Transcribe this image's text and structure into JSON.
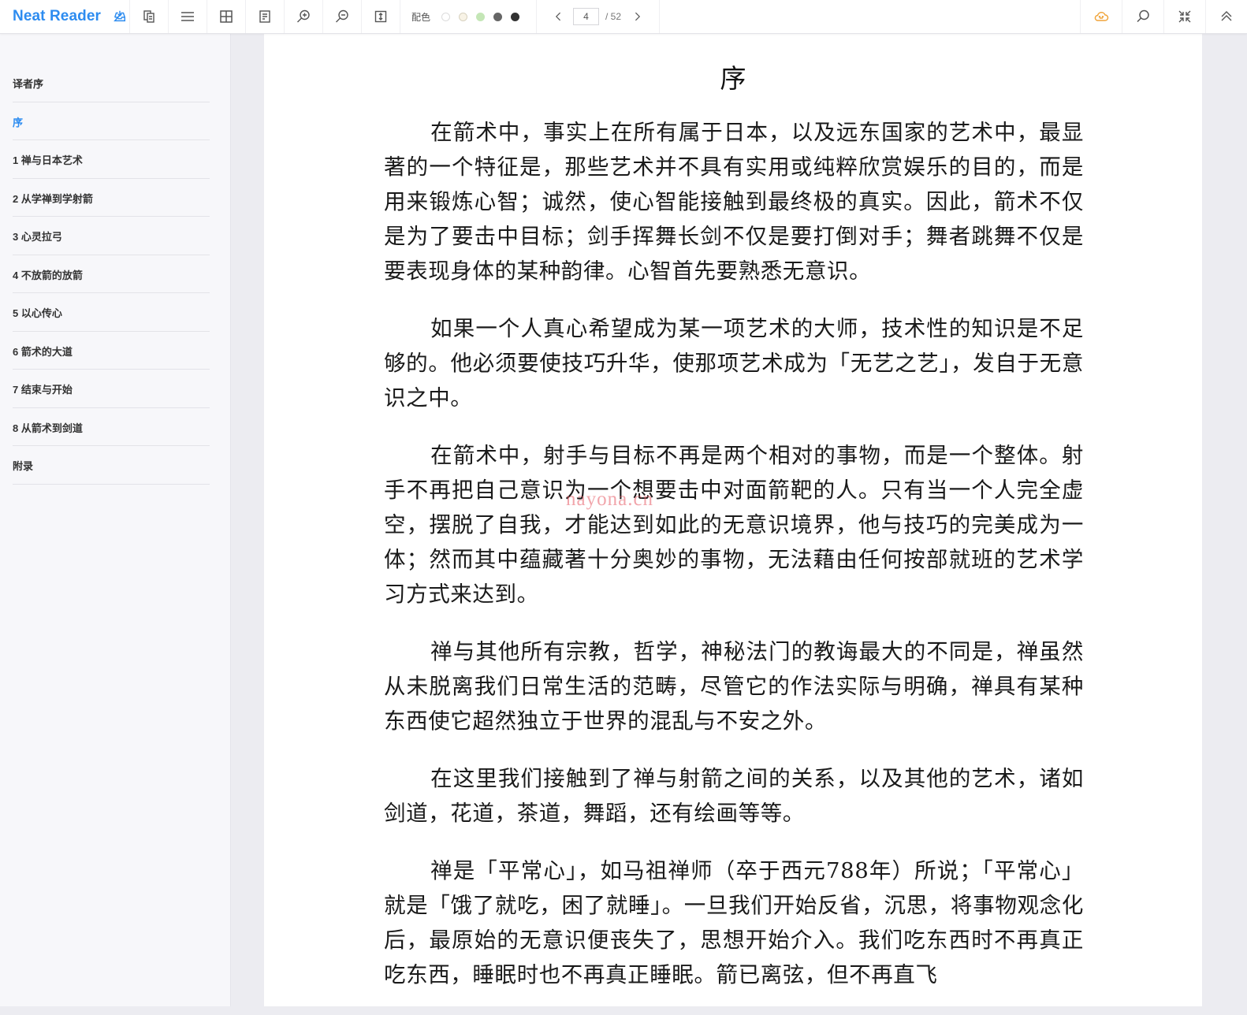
{
  "app": {
    "name": "Neat Reader"
  },
  "toolbar": {
    "buttons": [
      {
        "name": "import",
        "icon": "tray-download-icon"
      },
      {
        "name": "copy",
        "icon": "copy-icon"
      },
      {
        "name": "toc",
        "icon": "list-icon"
      },
      {
        "name": "layout",
        "icon": "grid-icon"
      },
      {
        "name": "notes",
        "icon": "document-icon"
      },
      {
        "name": "zoom-in",
        "icon": "zoom-in-icon"
      },
      {
        "name": "zoom-out",
        "icon": "zoom-out-icon"
      },
      {
        "name": "fit-height",
        "icon": "fit-vertical-icon"
      }
    ],
    "color_scheme": {
      "label": "配色",
      "swatches": [
        {
          "fill": "#ffffff",
          "border": "#dcdcdc"
        },
        {
          "fill": "#f8f3e6",
          "border": "#d8d2c0"
        },
        {
          "fill": "#c4e6b6",
          "border": "#c4e6b6"
        },
        {
          "fill": "#666666",
          "border": "#666666"
        },
        {
          "fill": "#333333",
          "border": "#333333"
        }
      ]
    },
    "pager": {
      "current_page": "4",
      "total": "/ 52"
    },
    "right_buttons": [
      {
        "name": "cloud-sync",
        "icon": "cloud-icon"
      },
      {
        "name": "search",
        "icon": "search-icon"
      },
      {
        "name": "fullscreen-exit",
        "icon": "compress-icon"
      },
      {
        "name": "collapse",
        "icon": "double-chevron-up-icon"
      }
    ]
  },
  "colors": {
    "accent": "#2d8cf0",
    "cloud": "#f0a43a"
  },
  "sidebar": {
    "toc": [
      {
        "label": "译者序",
        "active": false
      },
      {
        "label": "序",
        "active": true
      },
      {
        "label": "1 禅与日本艺术",
        "active": false
      },
      {
        "label": "2 从学禅到学射箭",
        "active": false
      },
      {
        "label": "3 心灵拉弓",
        "active": false
      },
      {
        "label": "4 不放箭的放箭",
        "active": false
      },
      {
        "label": "5 以心传心",
        "active": false
      },
      {
        "label": "6 箭术的大道",
        "active": false
      },
      {
        "label": "7 结束与开始",
        "active": false
      },
      {
        "label": "8 从箭术到剑道",
        "active": false
      },
      {
        "label": "附录",
        "active": false
      }
    ]
  },
  "page": {
    "title": "序",
    "paragraphs": [
      "在箭术中，事实上在所有属于日本，以及远东国家的艺术中，最显著的一个特征是，那些艺术并不具有实用或纯粹欣赏娱乐的目的，而是用来锻炼心智；诚然，使心智能接触到最终极的真实。因此，箭术不仅是为了要击中目标；剑手挥舞长剑不仅是要打倒对手；舞者跳舞不仅是要表现身体的某种韵律。心智首先要熟悉无意识。",
      "如果一个人真心希望成为某一项艺术的大师，技术性的知识是不足够的。他必须要使技巧升华，使那项艺术成为「无艺之艺」，发自于无意识之中。",
      "在箭术中，射手与目标不再是两个相对的事物，而是一个整体。射手不再把自己意识为一个想要击中对面箭靶的人。只有当一个人完全虚空，摆脱了自我，才能达到如此的无意识境界，他与技巧的完美成为一体；然而其中蕴藏著十分奥妙的事物，无法藉由任何按部就班的艺术学习方式来达到。",
      "禅与其他所有宗教，哲学，神秘法门的教诲最大的不同是，禅虽然从未脱离我们日常生活的范畴，尽管它的作法实际与明确，禅具有某种东西使它超然独立于世界的混乱与不安之外。",
      "在这里我们接触到了禅与射箭之间的关系，以及其他的艺术，诸如剑道，花道，茶道，舞蹈，还有绘画等等。",
      "禅是「平常心」，如马祖禅师（卒于西元788年）所说；「平常心」就是「饿了就吃，困了就睡」。一旦我们开始反省，沉思，将事物观念化后，最原始的无意识便丧失了，思想开始介入。我们吃东西时不再真正吃东西，睡眠时也不再真正睡眠。箭已离弦，但不再直飞"
    ],
    "watermark": "nayona.cn"
  }
}
